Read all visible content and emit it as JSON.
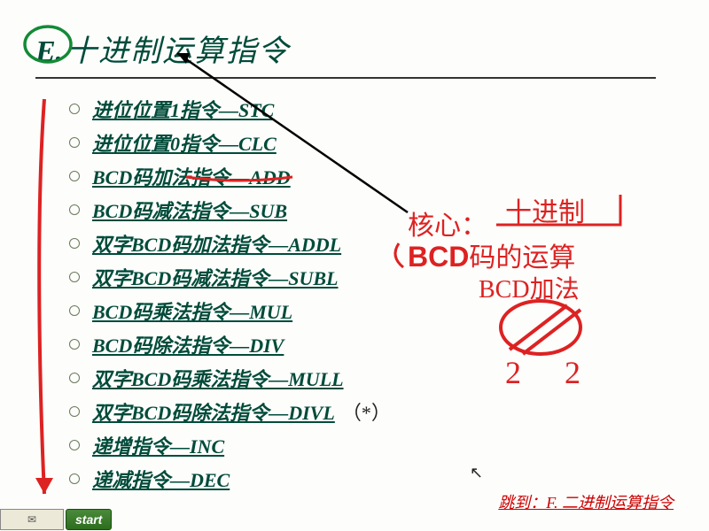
{
  "title": {
    "letter": "E.",
    "text": "十进制运算指令"
  },
  "items": [
    {
      "label": "进位位置1指令—STC"
    },
    {
      "label": "进位位置0指令—CLC"
    },
    {
      "label": "BCD码加法指令—ADD"
    },
    {
      "label": "BCD码减法指令—SUB"
    },
    {
      "label": "双字BCD码加法指令—ADDL"
    },
    {
      "label": "双字BCD码减法指令—SUBL"
    },
    {
      "label": "BCD码乘法指令—MUL"
    },
    {
      "label": "BCD码除法指令—DIV"
    },
    {
      "label": "双字BCD码乘法指令—MULL"
    },
    {
      "label": "双字BCD码除法指令—DIVL",
      "suffix": "（*）"
    },
    {
      "label": "递增指令—INC"
    },
    {
      "label": "递减指令—DEC"
    }
  ],
  "annotations": {
    "core_label": "核心：",
    "core_value_bcd": "BCD",
    "core_value_rest": "码的运算",
    "hand1": "十进制",
    "hand2": "BCD加法",
    "hand3": "2  2"
  },
  "jump": "跳到：F. 二进制运算指令",
  "taskbar": {
    "start": "start",
    "tray_icon": "✉"
  }
}
